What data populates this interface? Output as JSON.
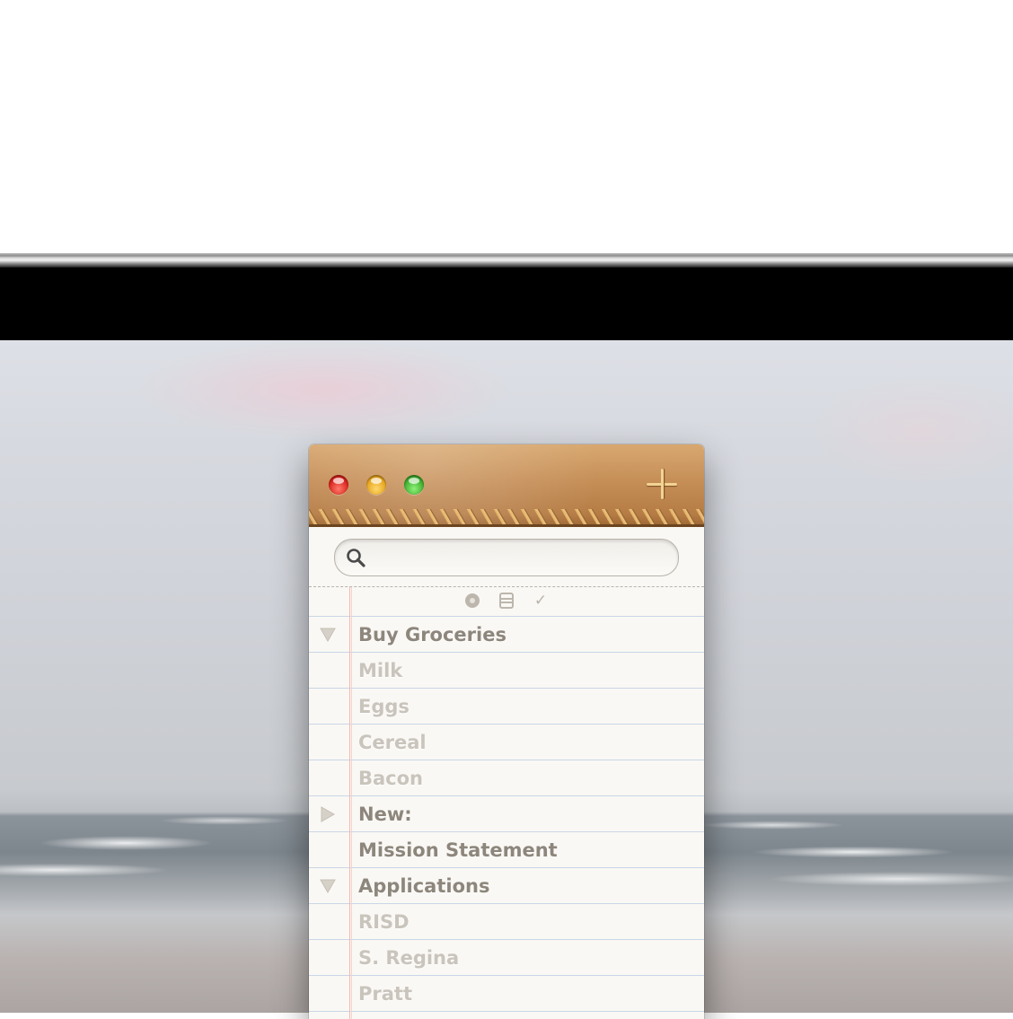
{
  "window": {
    "buttons": {
      "close_icon": "close-icon",
      "minimize_icon": "minimize-icon",
      "zoom_icon": "zoom-icon",
      "add_icon": "plus-icon"
    }
  },
  "search": {
    "placeholder": "",
    "value": "",
    "icon": "search-icon"
  },
  "toolbar": {
    "icons": [
      "circle-icon",
      "list-icon",
      "checkmark-icon"
    ],
    "check_glyph": "✓"
  },
  "items": [
    {
      "label": "Buy Groceries",
      "kind": "parent",
      "disclosure": "expanded"
    },
    {
      "label": "Milk",
      "kind": "child"
    },
    {
      "label": "Eggs",
      "kind": "child"
    },
    {
      "label": "Cereal",
      "kind": "child"
    },
    {
      "label": "Bacon",
      "kind": "child"
    },
    {
      "label": "New:",
      "kind": "parent",
      "disclosure": "collapsed"
    },
    {
      "label": "Mission Statement",
      "kind": "parent"
    },
    {
      "label": "Applications",
      "kind": "parent",
      "disclosure": "expanded"
    },
    {
      "label": "RISD",
      "kind": "child"
    },
    {
      "label": "S. Regina",
      "kind": "child"
    },
    {
      "label": "Pratt",
      "kind": "child"
    }
  ],
  "colors": {
    "leather": "#c68f58",
    "stitch": "#f0c780",
    "parent_text": "#8d867c",
    "child_text": "#c9c4bc",
    "rule_line": "#c9d6e8",
    "margin_line": "#f0b8b0"
  }
}
